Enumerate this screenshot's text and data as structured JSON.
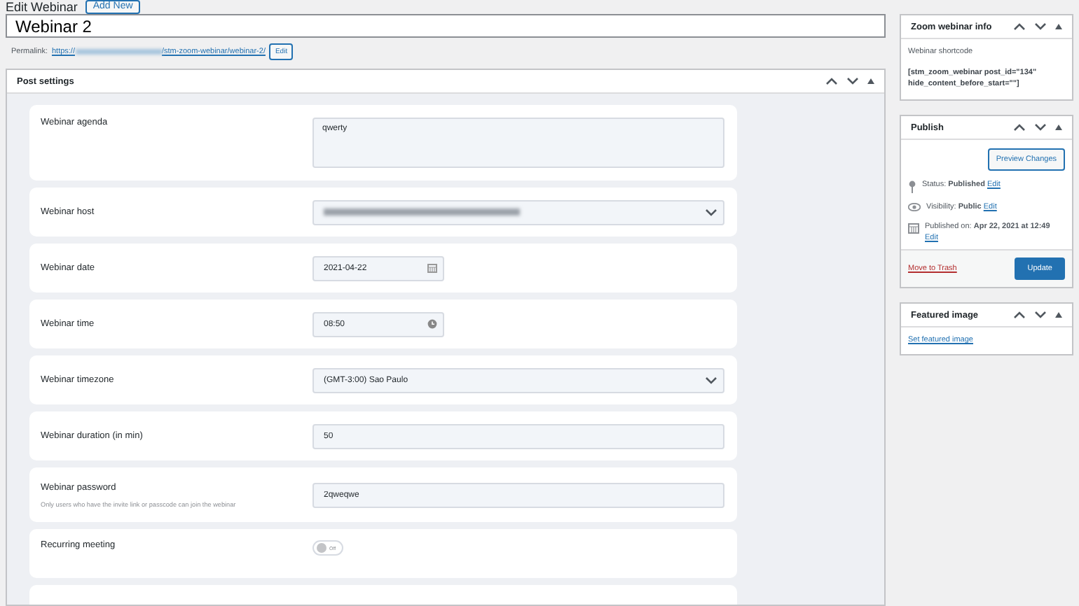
{
  "header": {
    "title": "Edit Webinar",
    "add_new": "Add New"
  },
  "post_title": "Webinar 2",
  "permalink": {
    "label": "Permalink:",
    "prefix": "https://",
    "path": "/stm-zoom-webinar/webinar-2/",
    "edit": "Edit"
  },
  "post_settings": {
    "title": "Post settings",
    "rows": [
      {
        "kind": "textarea",
        "label": "Webinar agenda",
        "value": "qwerty"
      },
      {
        "kind": "select",
        "label": "Webinar host",
        "redacted": true
      },
      {
        "kind": "date",
        "label": "Webinar date",
        "value": "2021-04-22"
      },
      {
        "kind": "time",
        "label": "Webinar time",
        "value": "08:50"
      },
      {
        "kind": "select",
        "label": "Webinar timezone",
        "value": "(GMT-3:00) Sao Paulo"
      },
      {
        "kind": "text",
        "label": "Webinar duration (in min)",
        "value": "50"
      },
      {
        "kind": "text",
        "label": "Webinar password",
        "description": "Only users who have the invite link or passcode can join the webinar",
        "value": "2qweqwe"
      },
      {
        "kind": "toggle",
        "label": "Recurring meeting",
        "on": false,
        "state_label": "Off"
      },
      {
        "kind": "empty"
      }
    ]
  },
  "zoom_info": {
    "title": "Zoom webinar info",
    "label": "Webinar shortcode",
    "shortcode": "[stm_zoom_webinar post_id=\"134\" hide_content_before_start=\"\"]"
  },
  "publish": {
    "title": "Publish",
    "preview": "Preview Changes",
    "meta": [
      {
        "kind": "status",
        "label": "Status:",
        "value": "Published",
        "edit": "Edit"
      },
      {
        "kind": "visibility",
        "label": "Visibility:",
        "value": "Public",
        "edit": "Edit"
      },
      {
        "kind": "date",
        "label": "Published on:",
        "value": "Apr 22, 2021 at 12:49",
        "edit": "Edit"
      }
    ],
    "trash": "Move to Trash",
    "update": "Update"
  },
  "featured_image": {
    "title": "Featured image",
    "link": "Set featured image"
  }
}
